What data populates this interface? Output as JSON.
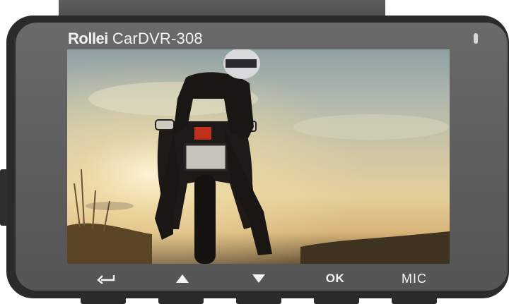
{
  "device": {
    "brand": "Rollei",
    "model": "CarDVR-308",
    "colors": {
      "bezel": "#5f5f5f",
      "shell": "#2b2b2b",
      "label": "#f2f2f2"
    }
  },
  "screen": {
    "content": "photo",
    "icons": [
      "sun-glow",
      "cloud",
      "motorcycle",
      "rider",
      "helmet",
      "tall-grass"
    ]
  },
  "buttons": [
    {
      "id": "back",
      "icon": "return-arrow-icon",
      "label": ""
    },
    {
      "id": "up",
      "icon": "triangle-up-icon",
      "label": ""
    },
    {
      "id": "down",
      "icon": "triangle-down-icon",
      "label": ""
    },
    {
      "id": "ok",
      "icon": "",
      "label": "OK"
    },
    {
      "id": "mic",
      "icon": "",
      "label": "MIC"
    }
  ]
}
